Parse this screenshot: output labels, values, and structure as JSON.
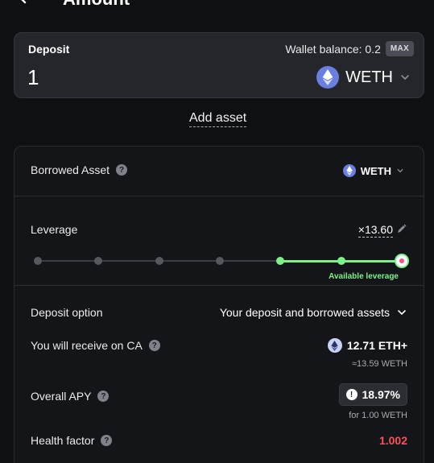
{
  "header": {
    "title": "Amount"
  },
  "deposit": {
    "label": "Deposit",
    "wallet_balance": "Wallet balance: 0.2",
    "max_label": "MAX",
    "amount_value": "1",
    "token": "WETH"
  },
  "add_asset_label": "Add asset",
  "borrowed_asset": {
    "label": "Borrowed Asset",
    "token": "WETH"
  },
  "leverage": {
    "label": "Leverage",
    "value": "×13.60",
    "available_label": "Available leverage",
    "ticks": 7,
    "available_from_tick": 5,
    "selected_tick": 7
  },
  "deposit_option": {
    "label": "Deposit option",
    "value": "Your deposit and borrowed assets"
  },
  "receive": {
    "label": "You will receive on CA",
    "amount": "12.71 ETH+",
    "approx": "≈13.59 WETH"
  },
  "overall_apy": {
    "label": "Overall APY",
    "value": "18.97%",
    "sub": "for 1.00 WETH"
  },
  "health_factor": {
    "label": "Health factor",
    "value": "1.002"
  },
  "colors": {
    "accent_green": "#7ef08a",
    "danger_red": "#ff4f58",
    "eth_blue": "#6b7fe0"
  }
}
